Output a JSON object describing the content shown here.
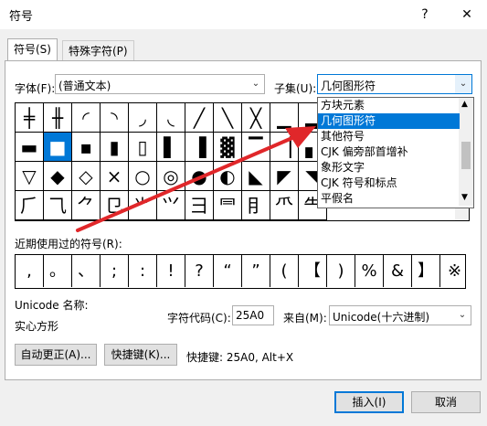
{
  "window": {
    "title": "符号",
    "help": "?",
    "close": "✕"
  },
  "tabs": [
    {
      "label": "符号(S)"
    },
    {
      "label": "特殊字符(P)"
    }
  ],
  "font": {
    "label": "字体(F):",
    "value": "(普通文本)"
  },
  "subset": {
    "label": "子集(U):",
    "value": "几何图形符"
  },
  "subset_options": [
    "方块元素",
    "几何图形符",
    "其他符号",
    "CJK 偏旁部首增补",
    "象形文字",
    "CJK 符号和标点",
    "平假名"
  ],
  "subset_selected_index": 1,
  "symbol_grid": [
    [
      "╪",
      "╫",
      "◜",
      "◝",
      "◞",
      "◟",
      "╱",
      "╲",
      "╳",
      "▁",
      "▂"
    ],
    [
      "▬",
      "■",
      "▪",
      "▮",
      "▯",
      "▌",
      "▐",
      "▓",
      "▔",
      "▕",
      "▖"
    ],
    [
      "▽",
      "◆",
      "◇",
      "×",
      "○",
      "◎",
      "●",
      "◐",
      "◣",
      "◤",
      "◥"
    ],
    [
      "⺁",
      "⺄",
      "⺈",
      "⺋",
      "⺌",
      "⺍",
      "⺕",
      "⺜",
      "⺝",
      "⺥",
      "⺧"
    ]
  ],
  "selected_cell": {
    "row": 1,
    "col": 1
  },
  "recent_label": "近期使用过的符号(R):",
  "recent_symbols": [
    ",",
    "。",
    "、",
    ";",
    ":",
    "!",
    "?",
    "“",
    "”",
    "(",
    "【",
    ")",
    "%",
    "&",
    "】",
    "※"
  ],
  "unicode_name_label": "Unicode 名称:",
  "unicode_name_value": "实心方形",
  "char_code": {
    "label": "字符代码(C):",
    "value": "25A0"
  },
  "from": {
    "label": "来自(M):",
    "value": "Unicode(十六进制)"
  },
  "buttons": {
    "autocorrect": "自动更正(A)...",
    "shortcut_key": "快捷键(K)...",
    "insert": "插入(I)",
    "cancel": "取消"
  },
  "shortcut_text": "快捷键: 25A0, Alt+X",
  "accent_color": "#0078d7",
  "annotation_color": "#e0272a"
}
